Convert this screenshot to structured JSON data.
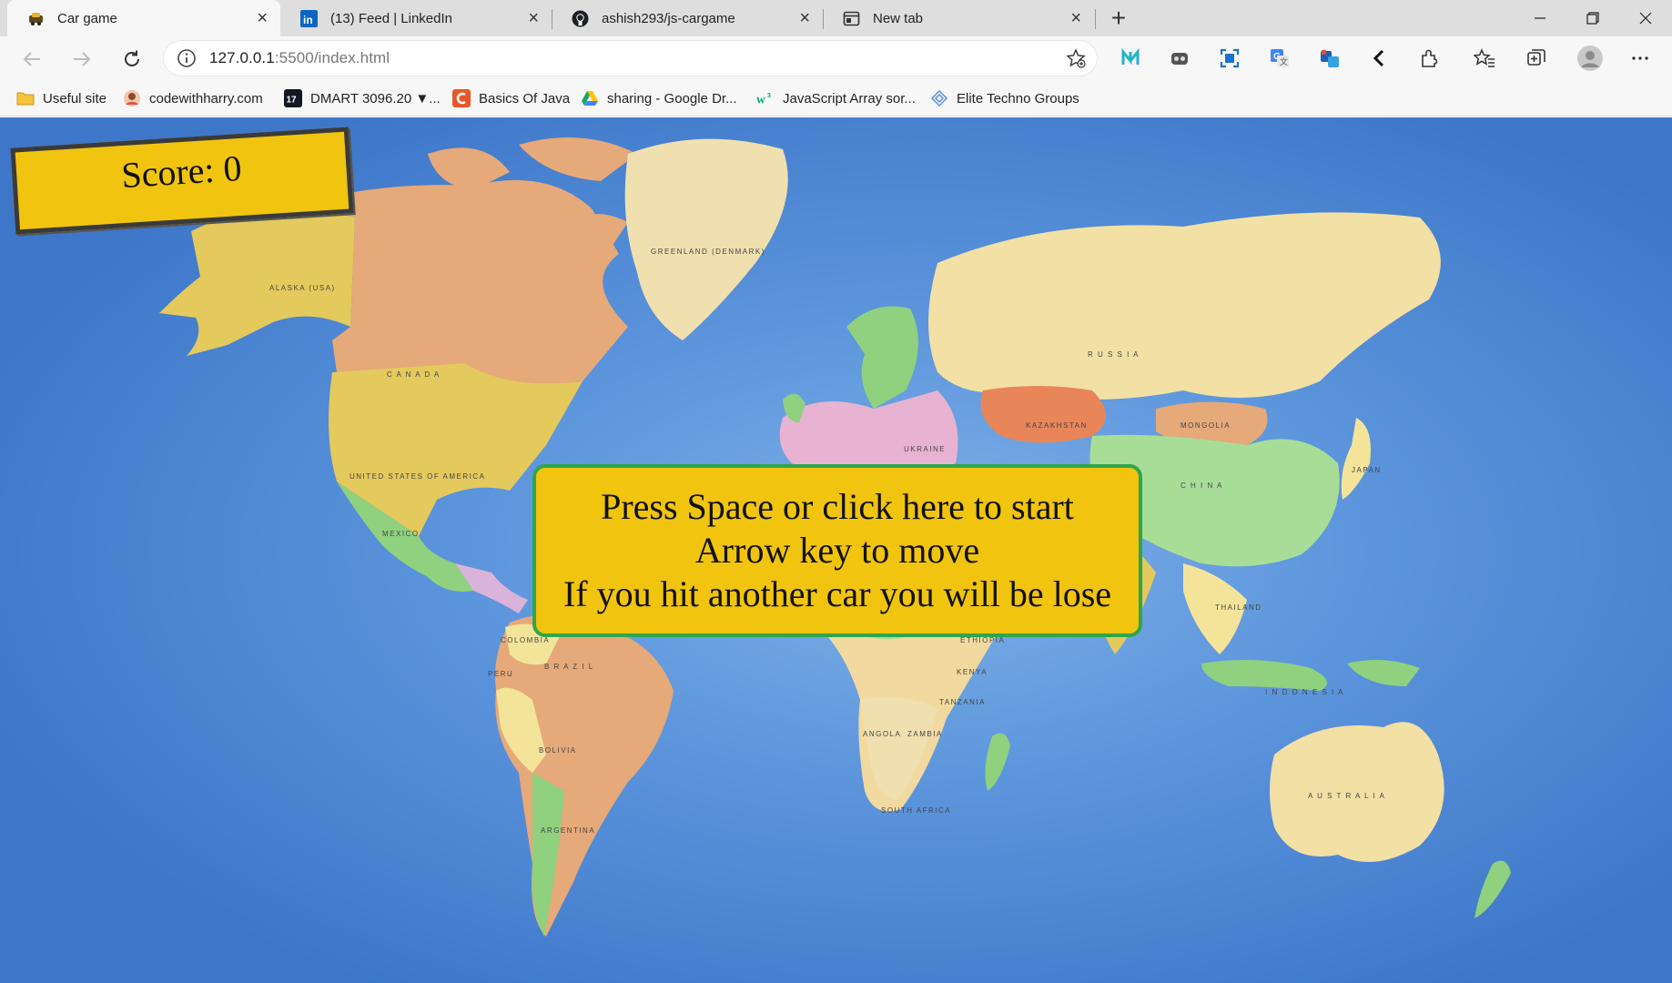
{
  "browser": {
    "tabs": [
      {
        "title": "Car game",
        "icon": "car-icon",
        "active": true
      },
      {
        "title": "(13) Feed | LinkedIn",
        "icon": "linkedin-icon",
        "active": false
      },
      {
        "title": "ashish293/js-cargame",
        "icon": "github-icon",
        "active": false
      },
      {
        "title": "New tab",
        "icon": "new-tab-icon",
        "active": false
      }
    ],
    "address": {
      "host": "127.0.0.1",
      "path": ":5500/index.html"
    },
    "bookmarks": [
      {
        "label": "Useful site",
        "icon": "folder-icon"
      },
      {
        "label": "codewithharry.com",
        "icon": "avatar-icon"
      },
      {
        "label": "DMART 3096.20 ▼...",
        "icon": "tradingview-icon"
      },
      {
        "label": "Basics Of Java",
        "icon": "c-logo-icon"
      },
      {
        "label": "sharing - Google Dr...",
        "icon": "google-drive-icon"
      },
      {
        "label": "JavaScript Array sor...",
        "icon": "w3-icon"
      },
      {
        "label": "Elite Techno Groups",
        "icon": "diamond-icon"
      }
    ]
  },
  "game": {
    "score_label": "Score: 0",
    "start_lines": [
      "Press Space or click here to start",
      "Arrow key to move",
      "If you hit another car you will be lose"
    ]
  },
  "map_labels": {
    "greenland": "GREENLAND (DENMARK)",
    "alaska": "ALASKA (USA)",
    "canada": "C A N A D A",
    "usa": "UNITED STATES OF AMERICA",
    "mexico": "MEXICO",
    "russia": "R U S S I A",
    "kazakhstan": "KAZAKHSTAN",
    "mongolia": "MONGOLIA",
    "china": "C H I N A",
    "japan": "JAPAN",
    "ukraine": "UKRAINE",
    "brazil": "B R A Z I L",
    "peru": "PERU",
    "bolivia": "BOLIVIA",
    "colombia": "COLOMBIA",
    "argentina": "ARGENTINA",
    "angola": "ANGOLA",
    "zambia": "ZAMBIA",
    "tanzania": "TANZANIA",
    "kenya": "KENYA",
    "ethiopia": "ETHIOPIA",
    "south_africa": "SOUTH AFRICA",
    "indonesia": "I N D O N E S I A",
    "australia": "A U S T R A L I A",
    "thailand": "THAILAND"
  }
}
